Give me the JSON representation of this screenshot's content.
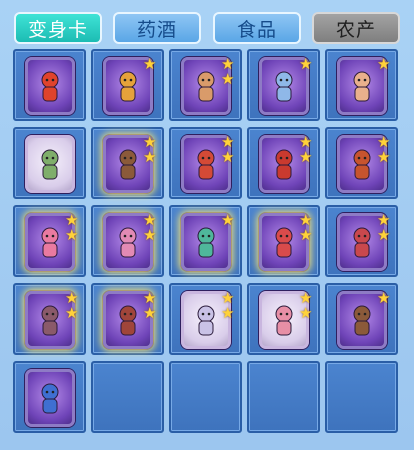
{
  "tabs": [
    {
      "label": "变身卡",
      "state": "active"
    },
    {
      "label": "药酒",
      "state": "normal"
    },
    {
      "label": "食品",
      "state": "normal"
    },
    {
      "label": "农产",
      "state": "disabled"
    }
  ],
  "colors": {
    "active_tab": "#1fc6bc",
    "normal_tab": "#6fb3ea",
    "disabled_tab": "#8a8a8a",
    "cell_bg": "#4479c5",
    "card_bg": "#7a4fc2",
    "star": "#ffd23a"
  },
  "grid": {
    "rows": [
      [
        {
          "icon": "monkey-card-icon",
          "stars": 0,
          "figure": "#e0432c"
        },
        {
          "icon": "lion-card-icon",
          "stars": 1,
          "figure": "#e6a23a"
        },
        {
          "icon": "warrior-card-icon",
          "stars": 2,
          "figure": "#d99b6a"
        },
        {
          "icon": "spirit-card-icon",
          "stars": 1,
          "figure": "#8fb8e8"
        },
        {
          "icon": "pig-card-icon",
          "stars": 1,
          "figure": "#e9b08c"
        }
      ],
      [
        {
          "icon": "monk-card-icon",
          "stars": 0,
          "figure": "#7fae6b",
          "light": true
        },
        {
          "icon": "bandit-card-icon",
          "stars": 2,
          "figure": "#8b5a3a",
          "glow": true
        },
        {
          "icon": "general-card-icon",
          "stars": 2,
          "figure": "#d44a36"
        },
        {
          "icon": "general-card-icon",
          "stars": 2,
          "figure": "#c93a2f"
        },
        {
          "icon": "general-card-icon",
          "stars": 2,
          "figure": "#c7542e"
        }
      ],
      [
        {
          "icon": "fairy-card-icon",
          "stars": 2,
          "figure": "#ea7aa0",
          "glow": true
        },
        {
          "icon": "fairy-card-icon",
          "stars": 2,
          "figure": "#e28ab4",
          "glow": true
        },
        {
          "icon": "dancer-card-icon",
          "stars": 1,
          "figure": "#4fb79b",
          "glow": true
        },
        {
          "icon": "girl-card-icon",
          "stars": 2,
          "figure": "#d94b4b",
          "glow": true
        },
        {
          "icon": "girl-card-icon",
          "stars": 2,
          "figure": "#c9484d"
        }
      ],
      [
        {
          "icon": "demon-card-icon",
          "stars": 2,
          "figure": "#8a5a6a",
          "glow": true
        },
        {
          "icon": "demon-card-icon",
          "stars": 2,
          "figure": "#a0453a",
          "glow": true
        },
        {
          "icon": "armor-card-icon",
          "stars": 2,
          "figure": "#c9c2e6",
          "light": true
        },
        {
          "icon": "maiden-card-icon",
          "stars": 2,
          "figure": "#e78fa6",
          "light": true
        },
        {
          "icon": "demon-card-icon",
          "stars": 1,
          "figure": "#8b5a3a"
        }
      ],
      [
        {
          "icon": "clown-card-icon",
          "stars": 0,
          "figure": "#3f6fd1"
        },
        null,
        null,
        null,
        null
      ]
    ]
  }
}
